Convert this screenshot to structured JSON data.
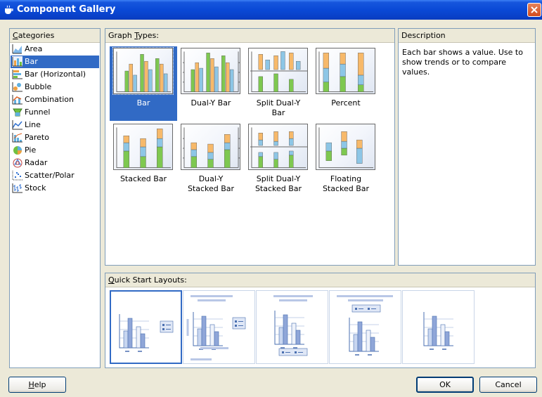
{
  "window": {
    "title": "Component Gallery"
  },
  "categories": {
    "header": {
      "before": "",
      "mnemonic": "C",
      "after": "ategories"
    },
    "items": [
      {
        "label": "Area",
        "icon": "area-chart-icon"
      },
      {
        "label": "Bar",
        "icon": "bar-chart-icon",
        "selected": true
      },
      {
        "label": "Bar (Horizontal)",
        "icon": "horizontal-bar-chart-icon"
      },
      {
        "label": "Bubble",
        "icon": "bubble-chart-icon"
      },
      {
        "label": "Combination",
        "icon": "combination-chart-icon"
      },
      {
        "label": "Funnel",
        "icon": "funnel-chart-icon"
      },
      {
        "label": "Line",
        "icon": "line-chart-icon"
      },
      {
        "label": "Pareto",
        "icon": "pareto-chart-icon"
      },
      {
        "label": "Pie",
        "icon": "pie-chart-icon"
      },
      {
        "label": "Radar",
        "icon": "radar-chart-icon"
      },
      {
        "label": "Scatter/Polar",
        "icon": "scatter-chart-icon"
      },
      {
        "label": "Stock",
        "icon": "stock-chart-icon"
      }
    ]
  },
  "graph_types": {
    "header": {
      "before": "Graph ",
      "mnemonic": "T",
      "after": "ypes:"
    },
    "items": [
      {
        "line1": "Bar",
        "line2": "",
        "selected": true
      },
      {
        "line1": "Dual-Y Bar",
        "line2": ""
      },
      {
        "line1": "Split Dual-Y",
        "line2": "Bar"
      },
      {
        "line1": "Percent",
        "line2": ""
      },
      {
        "line1": "Stacked Bar",
        "line2": ""
      },
      {
        "line1": "Dual-Y",
        "line2": "Stacked Bar"
      },
      {
        "line1": "Split Dual-Y",
        "line2": "Stacked Bar"
      },
      {
        "line1": "Floating",
        "line2": "Stacked Bar"
      }
    ]
  },
  "description": {
    "header": "Description",
    "text": "Each bar shows a value. Use to show trends or to compare values."
  },
  "quick_start": {
    "header": {
      "before": "",
      "mnemonic": "Q",
      "after": "uick Start Layouts:"
    },
    "selected_index": 0
  },
  "buttons": {
    "help": {
      "before": "",
      "mnemonic": "H",
      "after": "elp"
    },
    "ok": "OK",
    "cancel": "Cancel"
  },
  "colors": {
    "selection": "#316ac5",
    "bar_green": "#7ec850",
    "bar_orange": "#f7b96a",
    "bar_blue": "#8dc6e6",
    "frame": "#7f9db9"
  }
}
